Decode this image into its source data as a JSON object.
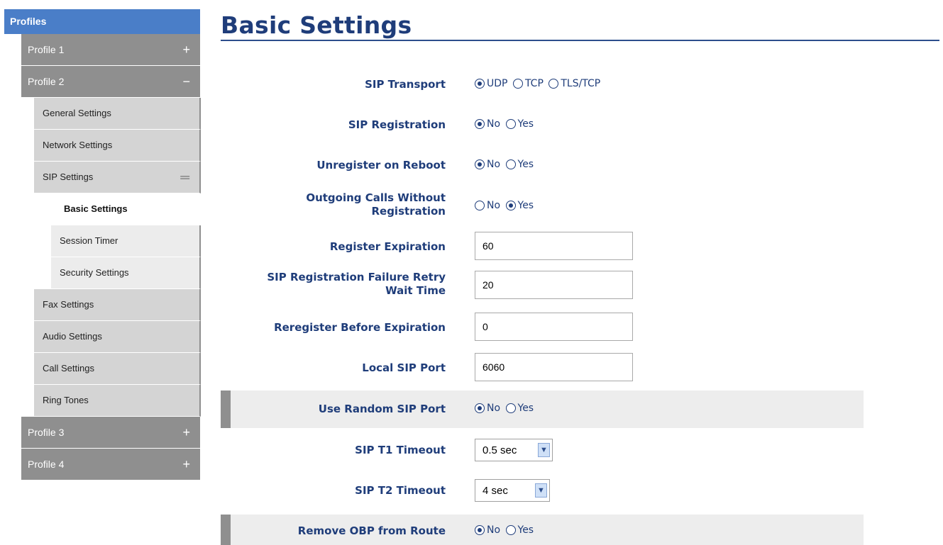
{
  "sidebar": {
    "header": "Profiles",
    "items": [
      {
        "level": 1,
        "label": "Profile 1",
        "symbol": "+"
      },
      {
        "level": 1,
        "label": "Profile 2",
        "symbol": "−"
      },
      {
        "level": 2,
        "label": "General Settings"
      },
      {
        "level": 2,
        "label": "Network Settings"
      },
      {
        "level": 2,
        "label": "SIP Settings",
        "symbol": "═"
      },
      {
        "level": 3,
        "label": "Basic Settings",
        "active": true
      },
      {
        "level": 3,
        "label": "Session Timer"
      },
      {
        "level": 3,
        "label": "Security Settings"
      },
      {
        "level": 2,
        "label": "Fax Settings"
      },
      {
        "level": 2,
        "label": "Audio Settings"
      },
      {
        "level": 2,
        "label": "Call Settings"
      },
      {
        "level": 2,
        "label": "Ring Tones"
      },
      {
        "level": 1,
        "label": "Profile 3",
        "symbol": "+"
      },
      {
        "level": 1,
        "label": "Profile 4",
        "symbol": "+"
      }
    ]
  },
  "main": {
    "title": "Basic Settings",
    "settings": {
      "sip_transport": {
        "label": "SIP Transport",
        "options": [
          "UDP",
          "TCP",
          "TLS/TCP"
        ],
        "selected": "UDP"
      },
      "sip_registration": {
        "label": "SIP Registration",
        "options": [
          "No",
          "Yes"
        ],
        "selected": "No"
      },
      "unregister_on_reboot": {
        "label": "Unregister on Reboot",
        "options": [
          "No",
          "Yes"
        ],
        "selected": "No"
      },
      "outgoing_calls_without_registration": {
        "label_line1": "Outgoing Calls Without",
        "label_line2": "Registration",
        "options": [
          "No",
          "Yes"
        ],
        "selected": "Yes"
      },
      "register_expiration": {
        "label": "Register Expiration",
        "value": "60"
      },
      "sip_registration_failure_retry_wait_time": {
        "label_line1": "SIP Registration Failure Retry",
        "label_line2": "Wait Time",
        "value": "20"
      },
      "reregister_before_expiration": {
        "label": "Reregister Before Expiration",
        "value": "0"
      },
      "local_sip_port": {
        "label": "Local SIP Port",
        "value": "6060"
      },
      "use_random_sip_port": {
        "label": "Use Random SIP Port",
        "options": [
          "No",
          "Yes"
        ],
        "selected": "No"
      },
      "sip_t1_timeout": {
        "label": "SIP T1 Timeout",
        "value": "0.5 sec"
      },
      "sip_t2_timeout": {
        "label": "SIP T2 Timeout",
        "value": "4 sec"
      },
      "remove_obp_from_route": {
        "label": "Remove OBP from Route",
        "options": [
          "No",
          "Yes"
        ],
        "selected": "No"
      }
    }
  },
  "icons": {
    "dropdown_arrow": "chevron-down-icon",
    "expand": "plus-icon",
    "collapse": "minus-icon"
  }
}
